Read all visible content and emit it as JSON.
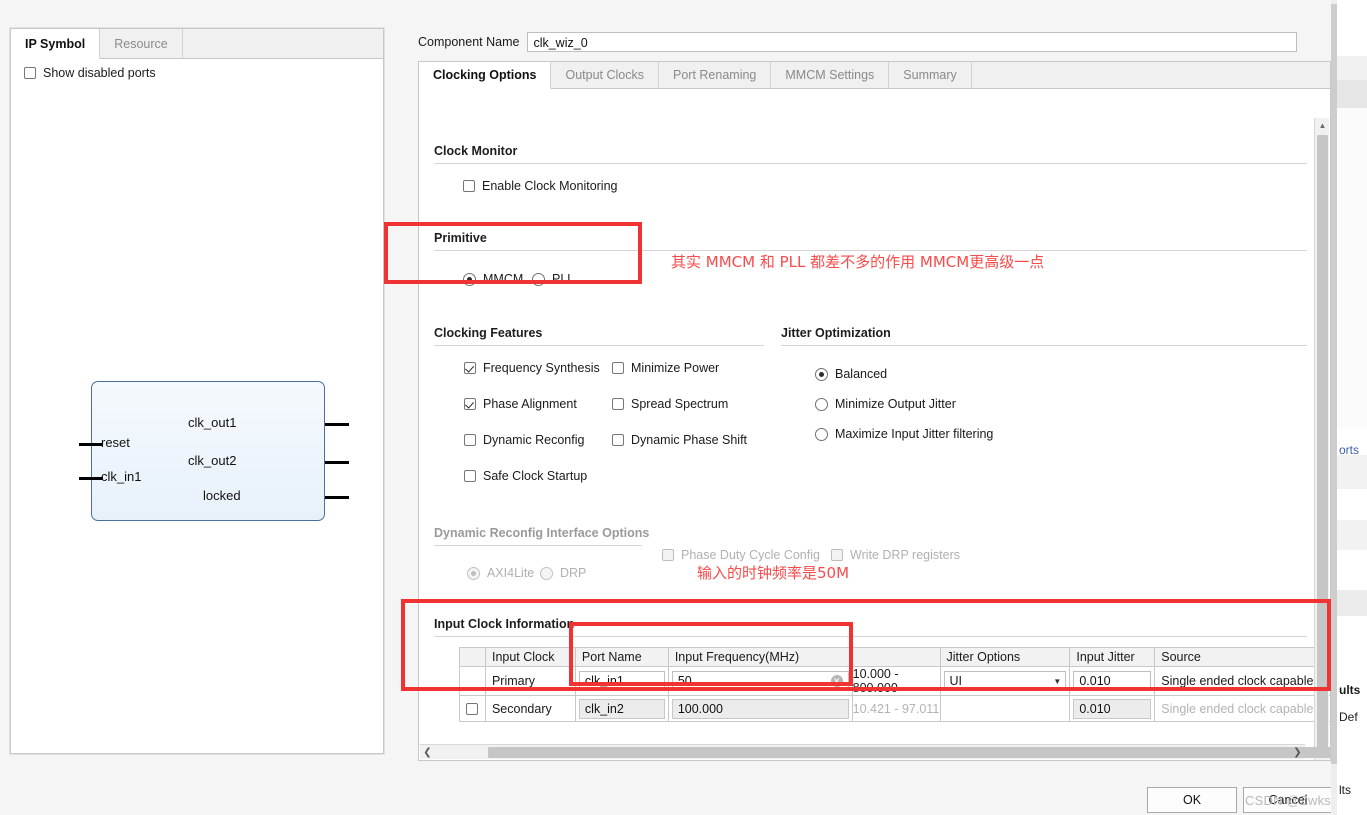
{
  "left_panel": {
    "tabs": [
      {
        "label": "IP Symbol",
        "active": true
      },
      {
        "label": "Resource",
        "active": false
      }
    ],
    "show_disabled_ports": {
      "label": "Show disabled ports",
      "checked": false
    },
    "symbol": {
      "inputs": [
        "reset",
        "clk_in1"
      ],
      "outputs": [
        "clk_out1",
        "clk_out2",
        "locked"
      ]
    }
  },
  "header": {
    "component_name_label": "Component Name",
    "component_name_value": "clk_wiz_0"
  },
  "main_tabs": [
    {
      "label": "Clocking Options",
      "active": true
    },
    {
      "label": "Output Clocks",
      "active": false
    },
    {
      "label": "Port Renaming",
      "active": false
    },
    {
      "label": "MMCM Settings",
      "active": false
    },
    {
      "label": "Summary",
      "active": false
    }
  ],
  "clock_monitor": {
    "title": "Clock Monitor",
    "enable": {
      "label": "Enable Clock Monitoring",
      "checked": false
    }
  },
  "primitive": {
    "title": "Primitive",
    "options": [
      {
        "label": "MMCM",
        "selected": true
      },
      {
        "label": "PLL",
        "selected": false
      }
    ]
  },
  "clocking_features": {
    "title": "Clocking Features",
    "col1": [
      {
        "label": "Frequency Synthesis",
        "checked": true
      },
      {
        "label": "Phase Alignment",
        "checked": true
      },
      {
        "label": "Dynamic Reconfig",
        "checked": false
      },
      {
        "label": "Safe Clock Startup",
        "checked": false
      }
    ],
    "col2": [
      {
        "label": "Minimize Power",
        "checked": false
      },
      {
        "label": "Spread Spectrum",
        "checked": false
      },
      {
        "label": "Dynamic Phase Shift",
        "checked": false
      }
    ]
  },
  "jitter_optimization": {
    "title": "Jitter Optimization",
    "options": [
      {
        "label": "Balanced",
        "selected": true
      },
      {
        "label": "Minimize Output Jitter",
        "selected": false
      },
      {
        "label": "Maximize Input Jitter filtering",
        "selected": false
      }
    ]
  },
  "dynamic_reconfig": {
    "title": "Dynamic Reconfig Interface Options",
    "radios": [
      {
        "label": "AXI4Lite",
        "selected": true,
        "disabled": true
      },
      {
        "label": "DRP",
        "selected": false,
        "disabled": true
      }
    ],
    "checks": [
      {
        "label": "Phase Duty Cycle Config",
        "checked": false,
        "disabled": true
      },
      {
        "label": "Write DRP registers",
        "checked": false,
        "disabled": true
      }
    ]
  },
  "input_clock_information": {
    "title": "Input Clock Information",
    "headers": [
      "",
      "Input Clock",
      "Port Name",
      "Input Frequency(MHz)",
      "",
      "Jitter Options",
      "Input Jitter",
      "Source"
    ],
    "rows": [
      {
        "enabled_checkbox": null,
        "input_clock": "Primary",
        "port_name": "clk_in1",
        "input_frequency": "50",
        "range": "10.000 - 800.000",
        "jitter_options": "UI",
        "input_jitter": "0.010",
        "source": "Single ended clock capable p",
        "disabled": false
      },
      {
        "enabled_checkbox": false,
        "input_clock": "Secondary",
        "port_name": "clk_in2",
        "input_frequency": "100.000",
        "range": "10.421 - 97.011",
        "jitter_options": "",
        "input_jitter": "0.010",
        "source": "Single ended clock capable p",
        "disabled": true
      }
    ]
  },
  "annotations": [
    {
      "text": "其实 MMCM 和 PLL 都差不多的作用 MMCM更高级一点"
    },
    {
      "text": "输入的时钟频率是50M"
    }
  ],
  "dialog_buttons": {
    "ok": "OK",
    "cancel": "Cancel"
  },
  "watermark": "CSDN @ZwksLoves",
  "peek": {
    "line1": "orts",
    "line2": "ults",
    "line3": "Def",
    "line4": "lts"
  },
  "colors": {
    "annotation_red": "#f03232",
    "annotation_text_red": "#fa4a4a",
    "symbol_border": "#4a6f9c",
    "panel_bg": "#f5f5f5"
  }
}
